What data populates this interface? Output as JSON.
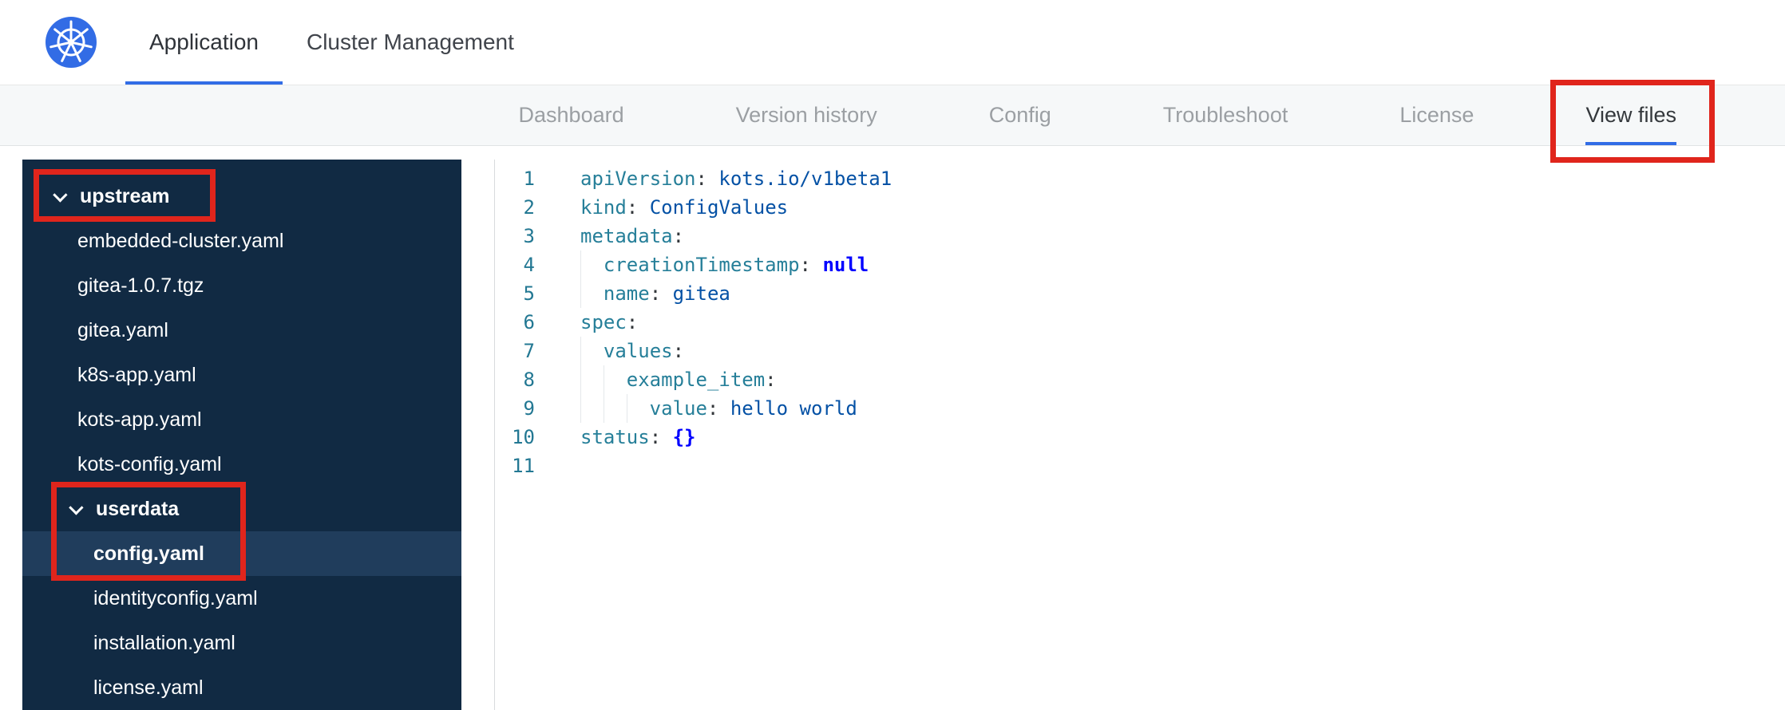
{
  "colors": {
    "kubernetes_blue": "#326ce5",
    "active_tab_underline": "#326de6",
    "annotation_red": "#e0251c",
    "sidebar_background": "#112a43",
    "sidebar_selected_background": "#203d5c",
    "yaml_key": "#267f99",
    "yaml_value": "#0451a5",
    "yaml_keyword": "#0000ff",
    "line_number": "#237893"
  },
  "header": {
    "tabs": [
      {
        "label": "Application",
        "active": true
      },
      {
        "label": "Cluster Management",
        "active": false
      }
    ]
  },
  "subnav": {
    "tabs": [
      {
        "label": "Dashboard",
        "active": false
      },
      {
        "label": "Version history",
        "active": false
      },
      {
        "label": "Config",
        "active": false
      },
      {
        "label": "Troubleshoot",
        "active": false
      },
      {
        "label": "License",
        "active": false
      },
      {
        "label": "View files",
        "active": true,
        "annotated": true
      }
    ]
  },
  "sidebar": {
    "tree": [
      {
        "type": "folder",
        "label": "upstream",
        "depth": 0,
        "expanded": true,
        "annotated": true
      },
      {
        "type": "file",
        "label": "embedded-cluster.yaml",
        "depth": 1
      },
      {
        "type": "file",
        "label": "gitea-1.0.7.tgz",
        "depth": 1
      },
      {
        "type": "file",
        "label": "gitea.yaml",
        "depth": 1
      },
      {
        "type": "file",
        "label": "k8s-app.yaml",
        "depth": 1
      },
      {
        "type": "file",
        "label": "kots-app.yaml",
        "depth": 1
      },
      {
        "type": "file",
        "label": "kots-config.yaml",
        "depth": 1
      },
      {
        "type": "folder",
        "label": "userdata",
        "depth": 1,
        "expanded": true,
        "annotated": true
      },
      {
        "type": "file",
        "label": "config.yaml",
        "depth": 2,
        "selected": true,
        "annotated": true
      },
      {
        "type": "file",
        "label": "identityconfig.yaml",
        "depth": 2
      },
      {
        "type": "file",
        "label": "installation.yaml",
        "depth": 2
      },
      {
        "type": "file",
        "label": "license.yaml",
        "depth": 2
      }
    ]
  },
  "editor": {
    "language": "yaml",
    "lines": [
      {
        "n": "1",
        "indent": 0,
        "tokens": [
          {
            "c": "key",
            "t": "apiVersion"
          },
          {
            "c": "pun",
            "t": ": "
          },
          {
            "c": "val",
            "t": "kots.io/v1beta1"
          }
        ]
      },
      {
        "n": "2",
        "indent": 0,
        "tokens": [
          {
            "c": "key",
            "t": "kind"
          },
          {
            "c": "pun",
            "t": ": "
          },
          {
            "c": "val",
            "t": "ConfigValues"
          }
        ]
      },
      {
        "n": "3",
        "indent": 0,
        "tokens": [
          {
            "c": "key",
            "t": "metadata"
          },
          {
            "c": "pun",
            "t": ":"
          }
        ]
      },
      {
        "n": "4",
        "indent": 1,
        "tokens": [
          {
            "c": "key",
            "t": "creationTimestamp"
          },
          {
            "c": "pun",
            "t": ": "
          },
          {
            "c": "kw",
            "t": "null"
          }
        ]
      },
      {
        "n": "5",
        "indent": 1,
        "tokens": [
          {
            "c": "key",
            "t": "name"
          },
          {
            "c": "pun",
            "t": ": "
          },
          {
            "c": "val",
            "t": "gitea"
          }
        ]
      },
      {
        "n": "6",
        "indent": 0,
        "tokens": [
          {
            "c": "key",
            "t": "spec"
          },
          {
            "c": "pun",
            "t": ":"
          }
        ]
      },
      {
        "n": "7",
        "indent": 1,
        "tokens": [
          {
            "c": "key",
            "t": "values"
          },
          {
            "c": "pun",
            "t": ":"
          }
        ]
      },
      {
        "n": "8",
        "indent": 2,
        "tokens": [
          {
            "c": "key",
            "t": "example_item"
          },
          {
            "c": "pun",
            "t": ":"
          }
        ]
      },
      {
        "n": "9",
        "indent": 3,
        "tokens": [
          {
            "c": "key",
            "t": "value"
          },
          {
            "c": "pun",
            "t": ": "
          },
          {
            "c": "val",
            "t": "hello world"
          }
        ]
      },
      {
        "n": "10",
        "indent": 0,
        "tokens": [
          {
            "c": "key",
            "t": "status"
          },
          {
            "c": "pun",
            "t": ": "
          },
          {
            "c": "kw",
            "t": "{}"
          }
        ]
      },
      {
        "n": "11",
        "indent": 0,
        "tokens": []
      }
    ]
  },
  "annotations": [
    {
      "id": "view-files",
      "target": "subnav-tab-view-files"
    },
    {
      "id": "upstream",
      "target": "folder-upstream"
    },
    {
      "id": "userdata-config",
      "target": "folder-userdata-and-file-config-yaml"
    }
  ]
}
